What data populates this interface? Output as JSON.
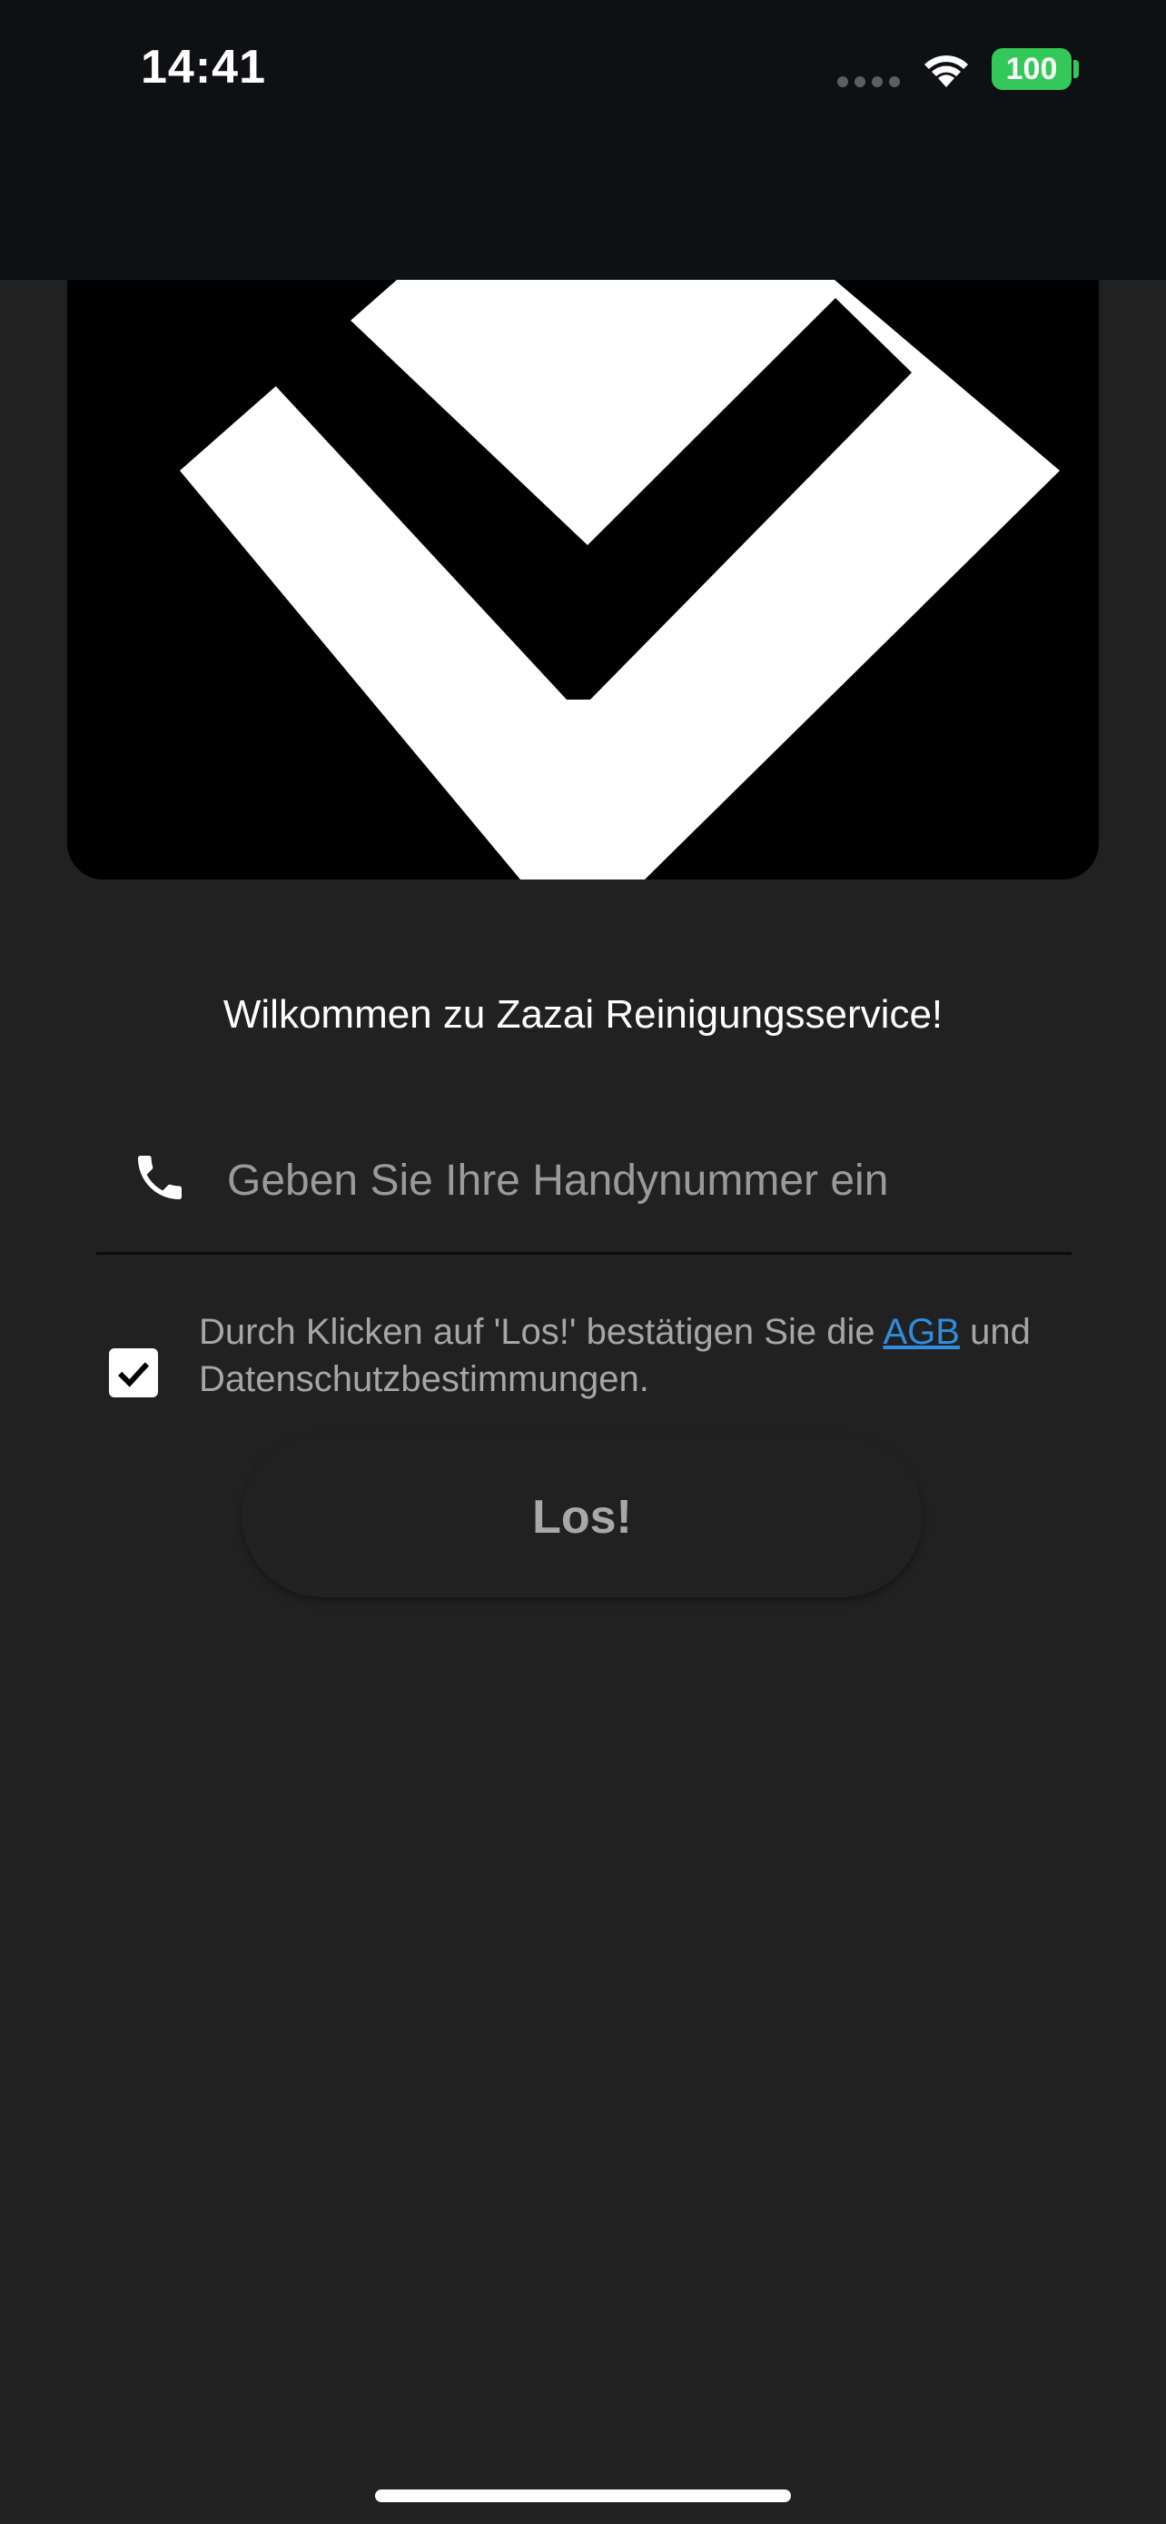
{
  "status_bar": {
    "time": "14:41",
    "battery": "100",
    "signal_icon": "cellular-signal-icon",
    "wifi_icon": "wifi-icon",
    "battery_color": "#34c759"
  },
  "logo": {
    "icon": "zazai-logo-chevron"
  },
  "welcome": {
    "text": "Wilkommen zu Zazai Reinigungsservice!"
  },
  "phone_field": {
    "icon": "phone-icon",
    "placeholder": "Geben Sie Ihre Handynummer ein",
    "value": ""
  },
  "terms": {
    "checked": true,
    "text_before": "Durch Klicken auf 'Los!' bestätigen Sie die ",
    "link_label": "AGB",
    "text_after": " und Datenschutzbestimmungen.",
    "link_color": "#2f8dde"
  },
  "submit": {
    "label": "Los!"
  }
}
